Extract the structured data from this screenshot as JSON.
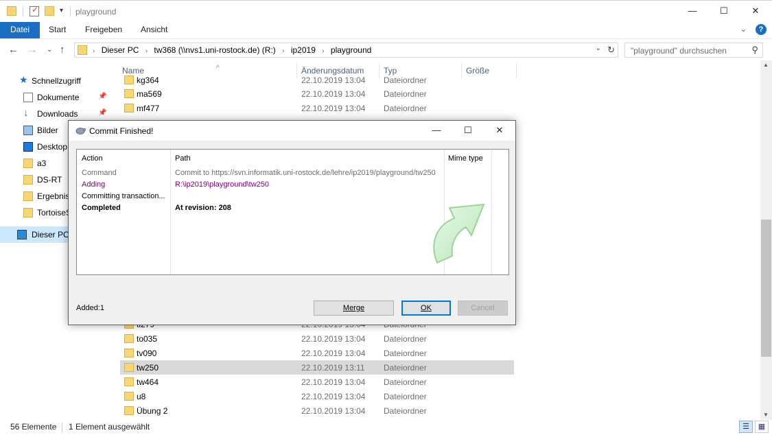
{
  "window": {
    "title": "playground",
    "minimize": "—",
    "maximize": "☐",
    "close": "✕"
  },
  "ribbon": {
    "tabs": [
      "Datei",
      "Start",
      "Freigeben",
      "Ansicht"
    ],
    "help": "?"
  },
  "address": {
    "crumbs": [
      "Dieser PC",
      "tw368 (\\\\nvs1.uni-rostock.de) (R:)",
      "ip2019",
      "playground"
    ],
    "search_placeholder": "\"playground\" durchsuchen"
  },
  "sidebar": {
    "items": [
      {
        "label": "Schnellzugriff",
        "icon": "star-icon"
      },
      {
        "label": "Dokumente",
        "icon": "document-icon",
        "pinned": true
      },
      {
        "label": "Downloads",
        "icon": "download-icon",
        "pinned": true
      },
      {
        "label": "Bilder",
        "icon": "pictures-icon"
      },
      {
        "label": "Desktop",
        "icon": "desktop-icon"
      },
      {
        "label": "a3",
        "icon": "folder-icon"
      },
      {
        "label": "DS-RT",
        "icon": "folder-icon"
      },
      {
        "label": "Ergebnis",
        "icon": "folder-icon"
      },
      {
        "label": "TortoiseS",
        "icon": "folder-icon"
      },
      {
        "label": "Dieser PC",
        "icon": "computer-icon"
      }
    ]
  },
  "list": {
    "columns": [
      "Name",
      "Änderungsdatum",
      "Typ",
      "Größe"
    ],
    "rows_top": [
      {
        "name": "kg364",
        "date": "22.10.2019 13:04",
        "type": "Dateiordner"
      },
      {
        "name": "ma569",
        "date": "22.10.2019 13:04",
        "type": "Dateiordner"
      },
      {
        "name": "mf477",
        "date": "22.10.2019 13:04",
        "type": "Dateiordner"
      }
    ],
    "rows_bottom": [
      {
        "name": "tl279",
        "date": "22.10.2019 13:04",
        "type": "Dateiordner"
      },
      {
        "name": "to035",
        "date": "22.10.2019 13:04",
        "type": "Dateiordner"
      },
      {
        "name": "tv090",
        "date": "22.10.2019 13:04",
        "type": "Dateiordner"
      },
      {
        "name": "tw250",
        "date": "22.10.2019 13:11",
        "type": "Dateiordner"
      },
      {
        "name": "tw464",
        "date": "22.10.2019 13:04",
        "type": "Dateiordner"
      },
      {
        "name": "u8",
        "date": "22.10.2019 13:04",
        "type": "Dateiordner"
      },
      {
        "name": "Übung 2",
        "date": "22.10.2019 13:04",
        "type": "Dateiordner"
      }
    ]
  },
  "status": {
    "count": "56 Elemente",
    "selected": "1 Element ausgewählt"
  },
  "dialog": {
    "title": "Commit Finished!",
    "columns": [
      "Action",
      "Path",
      "Mime type"
    ],
    "rows": [
      {
        "action": "Command",
        "path": "Commit to https://svn.informatik.uni-rostock.de/lehre/ip2019/playground/tw250",
        "style": "gray"
      },
      {
        "action": "Adding",
        "path": "R:\\ip2019\\playground\\tw250",
        "style": "purple"
      },
      {
        "action": "Committing transaction...",
        "path": "",
        "style": "black"
      },
      {
        "action": "Completed",
        "path": "At revision: 208",
        "style": "bold"
      }
    ],
    "status": "Added:1",
    "buttons": {
      "merge": "Merge",
      "ok": "OK",
      "cancel": "Cancel"
    }
  }
}
